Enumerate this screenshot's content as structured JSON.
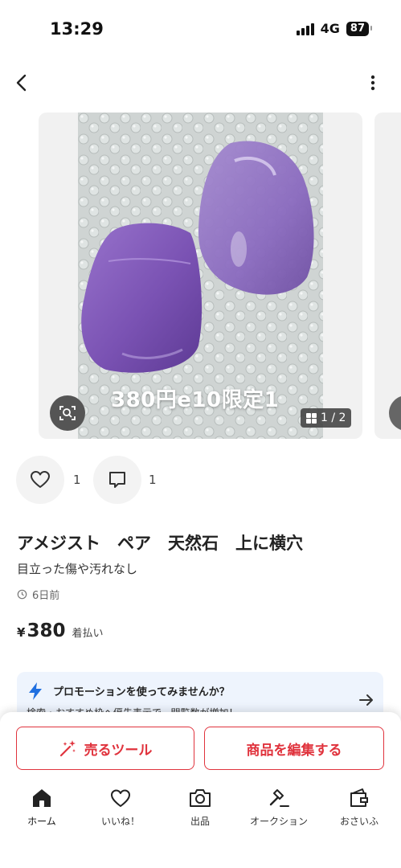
{
  "status_bar": {
    "time": "13:29",
    "network": "4G",
    "battery": "87"
  },
  "header": {
    "back_icon": "chevron-left-icon",
    "more_icon": "more-vertical-icon"
  },
  "carousel": {
    "caption": "380円e10限定1",
    "counter": "1 / 2",
    "lens_icon": "image-search-icon"
  },
  "actions": {
    "like_count": "1",
    "comment_count": "1"
  },
  "item": {
    "title": "アメジスト　ペア　天然石　上に横穴",
    "description": "目立った傷や汚れなし",
    "posted": "6日前",
    "currency": "¥",
    "price": "380",
    "shipping": "着払い"
  },
  "promo": {
    "title": "プロモーションを使ってみませんか？",
    "subtitle": "検索・おすすめ枠へ優先表示で、閲覧数が増加！",
    "accent_color": "#1f6fe0"
  },
  "buttons": {
    "sell_tool": "売るツール",
    "edit_item": "商品を編集する",
    "accent_color": "#e0333d"
  },
  "tabs": [
    {
      "label": "ホーム",
      "icon": "home-icon"
    },
    {
      "label": "いいね！",
      "icon": "heart-icon"
    },
    {
      "label": "出品",
      "icon": "camera-icon"
    },
    {
      "label": "オークション",
      "icon": "gavel-icon"
    },
    {
      "label": "おさいふ",
      "icon": "wallet-icon"
    }
  ]
}
